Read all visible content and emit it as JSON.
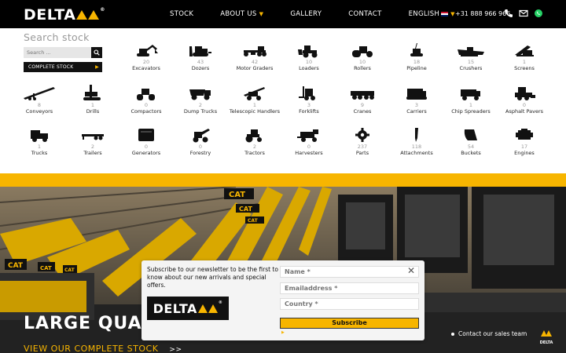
{
  "header": {
    "logo_text": "DELTA",
    "nav": {
      "stock": "STOCK",
      "about": "ABOUT US",
      "gallery": "GALLERY",
      "contact": "CONTACT",
      "language": "ENGLISH"
    },
    "phone": "+31 888 966 966",
    "icons": [
      "phone-icon",
      "mail-icon",
      "whatsapp-icon"
    ]
  },
  "search": {
    "title": "Search stock",
    "placeholder": "Search ...",
    "complete_stock_label": "COMPLETE STOCK"
  },
  "categories": [
    {
      "label": "Excavators",
      "count": "20",
      "icon": "excavator-icon"
    },
    {
      "label": "Dozers",
      "count": "43",
      "icon": "dozer-icon"
    },
    {
      "label": "Motor Graders",
      "count": "42",
      "icon": "grader-icon"
    },
    {
      "label": "Loaders",
      "count": "10",
      "icon": "loader-icon"
    },
    {
      "label": "Rollers",
      "count": "10",
      "icon": "roller-icon"
    },
    {
      "label": "Pipeline",
      "count": "18",
      "icon": "pipelayer-icon"
    },
    {
      "label": "Crushers",
      "count": "15",
      "icon": "crusher-icon"
    },
    {
      "label": "Screens",
      "count": "1",
      "icon": "screen-icon"
    },
    {
      "label": "Conveyors",
      "count": "8",
      "icon": "conveyor-icon"
    },
    {
      "label": "Drills",
      "count": "1",
      "icon": "drill-icon"
    },
    {
      "label": "Compactors",
      "count": "0",
      "icon": "compactor-icon"
    },
    {
      "label": "Dump Trucks",
      "count": "2",
      "icon": "dump-truck-icon"
    },
    {
      "label": "Telescopic Handlers",
      "count": "1",
      "icon": "telehandler-icon"
    },
    {
      "label": "Forklifts",
      "count": "3",
      "icon": "forklift-icon"
    },
    {
      "label": "Cranes",
      "count": "9",
      "icon": "crane-icon"
    },
    {
      "label": "Carriers",
      "count": "3",
      "icon": "carrier-icon"
    },
    {
      "label": "Chip Spreaders",
      "count": "1",
      "icon": "chip-spreader-icon"
    },
    {
      "label": "Asphalt Pavers",
      "count": "0",
      "icon": "paver-icon"
    },
    {
      "label": "Trucks",
      "count": "1",
      "icon": "truck-icon"
    },
    {
      "label": "Trailers",
      "count": "2",
      "icon": "trailer-icon"
    },
    {
      "label": "Generators",
      "count": "0",
      "icon": "generator-icon"
    },
    {
      "label": "Forestry",
      "count": "0",
      "icon": "forestry-icon"
    },
    {
      "label": "Tractors",
      "count": "2",
      "icon": "tractor-icon"
    },
    {
      "label": "Harvesters",
      "count": "0",
      "icon": "harvester-icon"
    },
    {
      "label": "Parts",
      "count": "237",
      "icon": "gear-icon"
    },
    {
      "label": "Attachments",
      "count": "118",
      "icon": "attachment-icon"
    },
    {
      "label": "Buckets",
      "count": "54",
      "icon": "bucket-icon"
    },
    {
      "label": "Engines",
      "count": "17",
      "icon": "engine-icon"
    }
  ],
  "hero": {
    "title": "LARGE QUANT",
    "link": "VIEW OUR COMPLETE STOCK",
    "link_chevrons": ">>"
  },
  "newsletter": {
    "text": "Subscribe to our newsletter to be the first to know about our new arrivals and special offers.",
    "logo_text": "DELTA",
    "name_placeholder": "Name *",
    "email_placeholder": "Emailaddress *",
    "country_placeholder": "Country *",
    "subscribe_label": "Subscribe",
    "close_label": "✕"
  },
  "contact_sales": "Contact our sales team",
  "mini_logo_text": "DELTA",
  "colors": {
    "accent": "#f7b500",
    "header_bg": "#000000",
    "text": "#222222"
  }
}
